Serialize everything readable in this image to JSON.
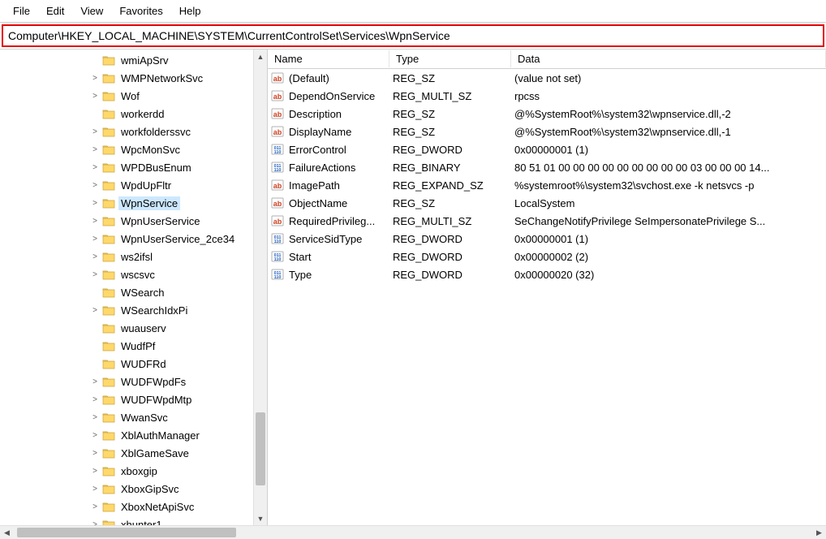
{
  "menu": {
    "items": [
      "File",
      "Edit",
      "View",
      "Favorites",
      "Help"
    ]
  },
  "address": "Computer\\HKEY_LOCAL_MACHINE\\SYSTEM\\CurrentControlSet\\Services\\WpnService",
  "tree": {
    "items": [
      {
        "chevron": "",
        "label": "wmiApSrv"
      },
      {
        "chevron": ">",
        "label": "WMPNetworkSvc"
      },
      {
        "chevron": ">",
        "label": "Wof"
      },
      {
        "chevron": "",
        "label": "workerdd"
      },
      {
        "chevron": ">",
        "label": "workfolderssvc"
      },
      {
        "chevron": ">",
        "label": "WpcMonSvc"
      },
      {
        "chevron": ">",
        "label": "WPDBusEnum"
      },
      {
        "chevron": ">",
        "label": "WpdUpFltr"
      },
      {
        "chevron": ">",
        "label": "WpnService",
        "selected": true
      },
      {
        "chevron": ">",
        "label": "WpnUserService"
      },
      {
        "chevron": ">",
        "label": "WpnUserService_2ce34"
      },
      {
        "chevron": ">",
        "label": "ws2ifsl"
      },
      {
        "chevron": ">",
        "label": "wscsvc"
      },
      {
        "chevron": "",
        "label": "WSearch"
      },
      {
        "chevron": ">",
        "label": "WSearchIdxPi"
      },
      {
        "chevron": "",
        "label": "wuauserv"
      },
      {
        "chevron": "",
        "label": "WudfPf"
      },
      {
        "chevron": "",
        "label": "WUDFRd"
      },
      {
        "chevron": ">",
        "label": "WUDFWpdFs"
      },
      {
        "chevron": ">",
        "label": "WUDFWpdMtp"
      },
      {
        "chevron": ">",
        "label": "WwanSvc"
      },
      {
        "chevron": ">",
        "label": "XblAuthManager"
      },
      {
        "chevron": ">",
        "label": "XblGameSave"
      },
      {
        "chevron": ">",
        "label": "xboxgip"
      },
      {
        "chevron": ">",
        "label": "XboxGipSvc"
      },
      {
        "chevron": ">",
        "label": "XboxNetApiSvc"
      },
      {
        "chevron": ">",
        "label": "xhunter1"
      }
    ]
  },
  "list": {
    "columns": {
      "name": "Name",
      "type": "Type",
      "data": "Data"
    },
    "rows": [
      {
        "icon": "str",
        "name": "(Default)",
        "type": "REG_SZ",
        "data": "(value not set)"
      },
      {
        "icon": "str",
        "name": "DependOnService",
        "type": "REG_MULTI_SZ",
        "data": "rpcss"
      },
      {
        "icon": "str",
        "name": "Description",
        "type": "REG_SZ",
        "data": "@%SystemRoot%\\system32\\wpnservice.dll,-2"
      },
      {
        "icon": "str",
        "name": "DisplayName",
        "type": "REG_SZ",
        "data": "@%SystemRoot%\\system32\\wpnservice.dll,-1"
      },
      {
        "icon": "bin",
        "name": "ErrorControl",
        "type": "REG_DWORD",
        "data": "0x00000001 (1)"
      },
      {
        "icon": "bin",
        "name": "FailureActions",
        "type": "REG_BINARY",
        "data": "80 51 01 00 00 00 00 00 00 00 00 00 03 00 00 00 14..."
      },
      {
        "icon": "str",
        "name": "ImagePath",
        "type": "REG_EXPAND_SZ",
        "data": "%systemroot%\\system32\\svchost.exe -k netsvcs -p"
      },
      {
        "icon": "str",
        "name": "ObjectName",
        "type": "REG_SZ",
        "data": "LocalSystem"
      },
      {
        "icon": "str",
        "name": "RequiredPrivileg...",
        "type": "REG_MULTI_SZ",
        "data": "SeChangeNotifyPrivilege SeImpersonatePrivilege S..."
      },
      {
        "icon": "bin",
        "name": "ServiceSidType",
        "type": "REG_DWORD",
        "data": "0x00000001 (1)"
      },
      {
        "icon": "bin",
        "name": "Start",
        "type": "REG_DWORD",
        "data": "0x00000002 (2)"
      },
      {
        "icon": "bin",
        "name": "Type",
        "type": "REG_DWORD",
        "data": "0x00000020 (32)"
      }
    ]
  }
}
